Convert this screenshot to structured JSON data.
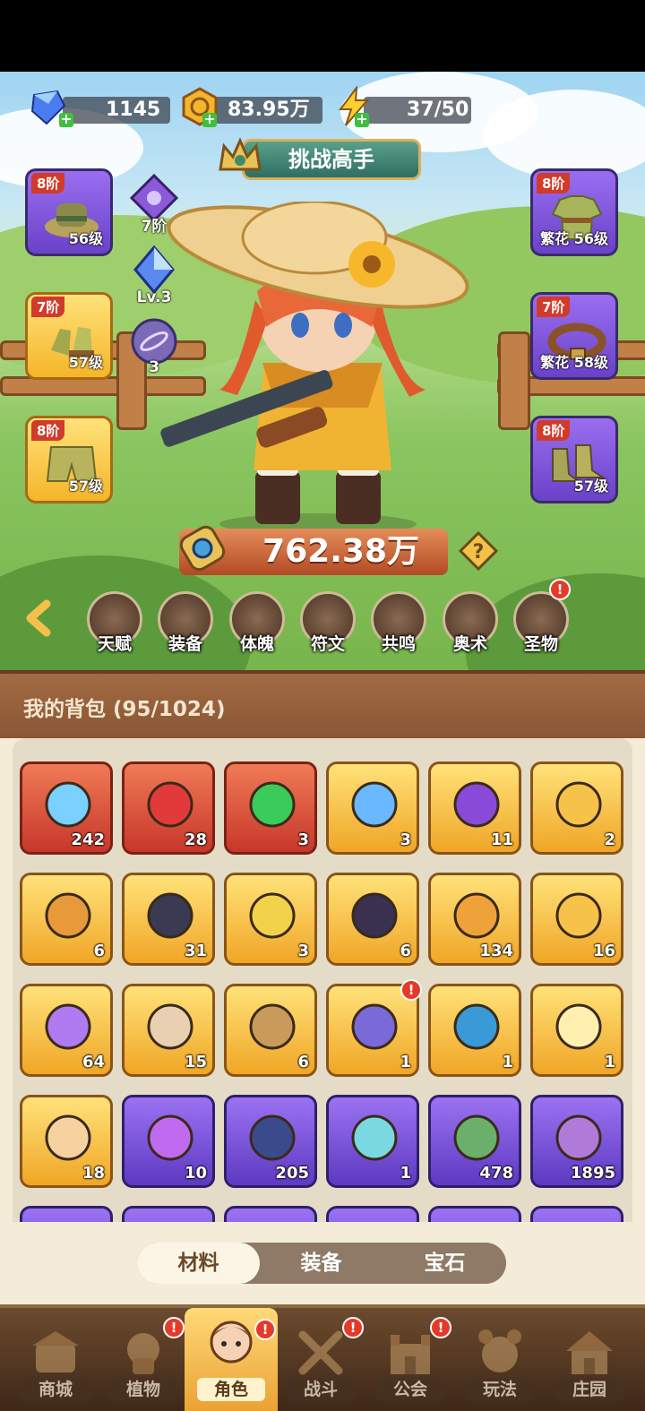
{
  "currencies": {
    "gems": "1145",
    "gold": "83.95万",
    "energy": "37/50"
  },
  "challenge_label": "挑战高手",
  "equip_left": [
    {
      "tier": "8阶",
      "level": "56级",
      "rarity": "purple",
      "icon": "hat-icon"
    },
    {
      "tier": "7阶",
      "level": "57级",
      "rarity": "gold",
      "icon": "gloves-icon"
    },
    {
      "tier": "8阶",
      "level": "57级",
      "rarity": "gold",
      "icon": "shorts-icon"
    }
  ],
  "equip_right": [
    {
      "tier": "8阶",
      "level": "繁花 56级",
      "rarity": "purple",
      "icon": "shirt-icon"
    },
    {
      "tier": "7阶",
      "level": "繁花 58级",
      "rarity": "purple",
      "icon": "belt-icon"
    },
    {
      "tier": "8阶",
      "level": "57级",
      "rarity": "purple",
      "icon": "boots-icon"
    }
  ],
  "mini_stats": {
    "pet_tier": "7阶",
    "crystal_level": "Lv.3",
    "orb_count": "3"
  },
  "power": "762.38万",
  "functions": [
    {
      "label": "天赋",
      "icon": "talent-icon",
      "badge": false
    },
    {
      "label": "装备",
      "icon": "equipment-icon",
      "badge": false
    },
    {
      "label": "体魄",
      "icon": "physique-icon",
      "badge": false
    },
    {
      "label": "符文",
      "icon": "rune-icon",
      "badge": false
    },
    {
      "label": "共鸣",
      "icon": "resonance-icon",
      "badge": false
    },
    {
      "label": "奥术",
      "icon": "arcane-icon",
      "badge": false
    },
    {
      "label": "圣物",
      "icon": "relic-icon",
      "badge": true
    }
  ],
  "bag": {
    "title": "我的背包 (95/1024)",
    "items": [
      {
        "count": "242",
        "rarity": "red",
        "icon": "star-crystal-icon"
      },
      {
        "count": "28",
        "rarity": "red",
        "icon": "red-potion-icon"
      },
      {
        "count": "3",
        "rarity": "red",
        "icon": "green-capsule-icon"
      },
      {
        "count": "3",
        "rarity": "gold",
        "icon": "water-drop-icon"
      },
      {
        "count": "11",
        "rarity": "gold",
        "icon": "skull-token-icon"
      },
      {
        "count": "2",
        "rarity": "gold",
        "icon": "gold-key-icon"
      },
      {
        "count": "6",
        "rarity": "gold",
        "icon": "rune-key-icon"
      },
      {
        "count": "31",
        "rarity": "gold",
        "icon": "fire-prism-icon"
      },
      {
        "count": "3",
        "rarity": "gold",
        "icon": "golden-rose-icon"
      },
      {
        "count": "6",
        "rarity": "gold",
        "icon": "spiral-stone-icon"
      },
      {
        "count": "134",
        "rarity": "gold",
        "icon": "orange-potion-icon"
      },
      {
        "count": "16",
        "rarity": "gold",
        "icon": "gold-pile-icon"
      },
      {
        "count": "64",
        "rarity": "gold",
        "icon": "spell-book-icon"
      },
      {
        "count": "15",
        "rarity": "gold",
        "icon": "jar-icon"
      },
      {
        "count": "6",
        "rarity": "gold",
        "icon": "chick-icon"
      },
      {
        "count": "1",
        "rarity": "gold",
        "icon": "scroll-icon",
        "badge": true
      },
      {
        "count": "1",
        "rarity": "gold",
        "icon": "blueprint-icon"
      },
      {
        "count": "1",
        "rarity": "gold",
        "icon": "flower-orb-icon"
      },
      {
        "count": "18",
        "rarity": "gold",
        "icon": "knot-rune-icon"
      },
      {
        "count": "10",
        "rarity": "purple",
        "icon": "purple-perfume-icon"
      },
      {
        "count": "205",
        "rarity": "purple",
        "icon": "hex-coin-icon"
      },
      {
        "count": "1",
        "rarity": "purple",
        "icon": "blue-leaf-icon"
      },
      {
        "count": "478",
        "rarity": "purple",
        "icon": "green-scroll-icon"
      },
      {
        "count": "1895",
        "rarity": "purple",
        "icon": "purple-scroll-icon"
      }
    ]
  },
  "tabs": [
    {
      "label": "材料",
      "active": true
    },
    {
      "label": "装备",
      "active": false
    },
    {
      "label": "宝石",
      "active": false
    }
  ],
  "bottom_nav": [
    {
      "label": "商城",
      "icon": "shop-icon",
      "badge": false,
      "active": false
    },
    {
      "label": "植物",
      "icon": "plant-icon",
      "badge": true,
      "active": false
    },
    {
      "label": "角色",
      "icon": "character-icon",
      "badge": true,
      "active": true
    },
    {
      "label": "战斗",
      "icon": "battle-icon",
      "badge": true,
      "active": false
    },
    {
      "label": "公会",
      "icon": "guild-icon",
      "badge": true,
      "active": false
    },
    {
      "label": "玩法",
      "icon": "modes-icon",
      "badge": false,
      "active": false
    },
    {
      "label": "庄园",
      "icon": "manor-icon",
      "badge": false,
      "active": false
    }
  ]
}
